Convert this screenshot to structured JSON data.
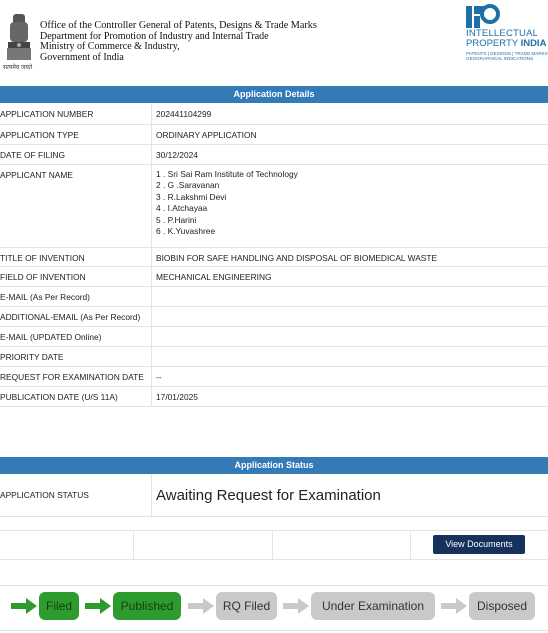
{
  "header": {
    "emblem_caption": "सत्यमेव जयते",
    "org_line1": "Office of the Controller General of Patents, Designs & Trade Marks",
    "org_line2": "Department for Promotion of Industry and Internal Trade",
    "org_line3": "Ministry of Commerce & Industry,",
    "org_line4": "Government of India",
    "ip_line1": "INTELLECTUAL",
    "ip_line2a": "PROPERTY ",
    "ip_line2b": "INDIA",
    "ip_line3": "PATENTS | DESIGNS | TRADE MARKS",
    "ip_line4": "GEOGRAPHICAL INDICATIONS"
  },
  "details": {
    "title": "Application Details",
    "rows": [
      {
        "label": "APPLICATION NUMBER",
        "value": "202441104299"
      },
      {
        "label": "APPLICATION TYPE",
        "value": "ORDINARY APPLICATION"
      },
      {
        "label": "DATE OF FILING",
        "value": "30/12/2024"
      },
      {
        "label": "APPLICANT NAME",
        "values": [
          "1 . Sri Sai Ram Institute of Technology",
          "2 . G .Saravanan",
          "3 . R.Lakshmi Devi",
          "4 . I.Atchayaa",
          "5 . P.Harini",
          "6 . K.Yuvashree"
        ]
      },
      {
        "label": "TITLE OF INVENTION",
        "value": "BIOBIN FOR SAFE HANDLING AND DISPOSAL OF BIOMEDICAL WASTE"
      },
      {
        "label": "FIELD OF INVENTION",
        "value": "MECHANICAL ENGINEERING"
      },
      {
        "label": "E-MAIL (As Per Record)",
        "value": ""
      },
      {
        "label": "ADDITIONAL-EMAIL (As Per Record)",
        "value": ""
      },
      {
        "label": "E-MAIL (UPDATED Online)",
        "value": ""
      },
      {
        "label": "PRIORITY DATE",
        "value": ""
      },
      {
        "label": "REQUEST FOR EXAMINATION DATE",
        "value": "--"
      },
      {
        "label": "PUBLICATION DATE (U/S 11A)",
        "value": "17/01/2025"
      }
    ]
  },
  "status": {
    "title": "Application Status",
    "label": "APPLICATION STATUS",
    "value": "Awaiting Request for Examination",
    "view_documents": "View Documents"
  },
  "flow": {
    "stages": [
      {
        "label": "Filed",
        "state": "done"
      },
      {
        "label": "Published",
        "state": "done"
      },
      {
        "label": "RQ Filed",
        "state": "pending"
      },
      {
        "label": "Under Examination",
        "state": "pending"
      },
      {
        "label": "Disposed",
        "state": "pending"
      }
    ]
  },
  "colors": {
    "bar": "#337ab7",
    "button": "#16325c",
    "done": "#2e9b2e",
    "pending": "#c9c9c9"
  }
}
